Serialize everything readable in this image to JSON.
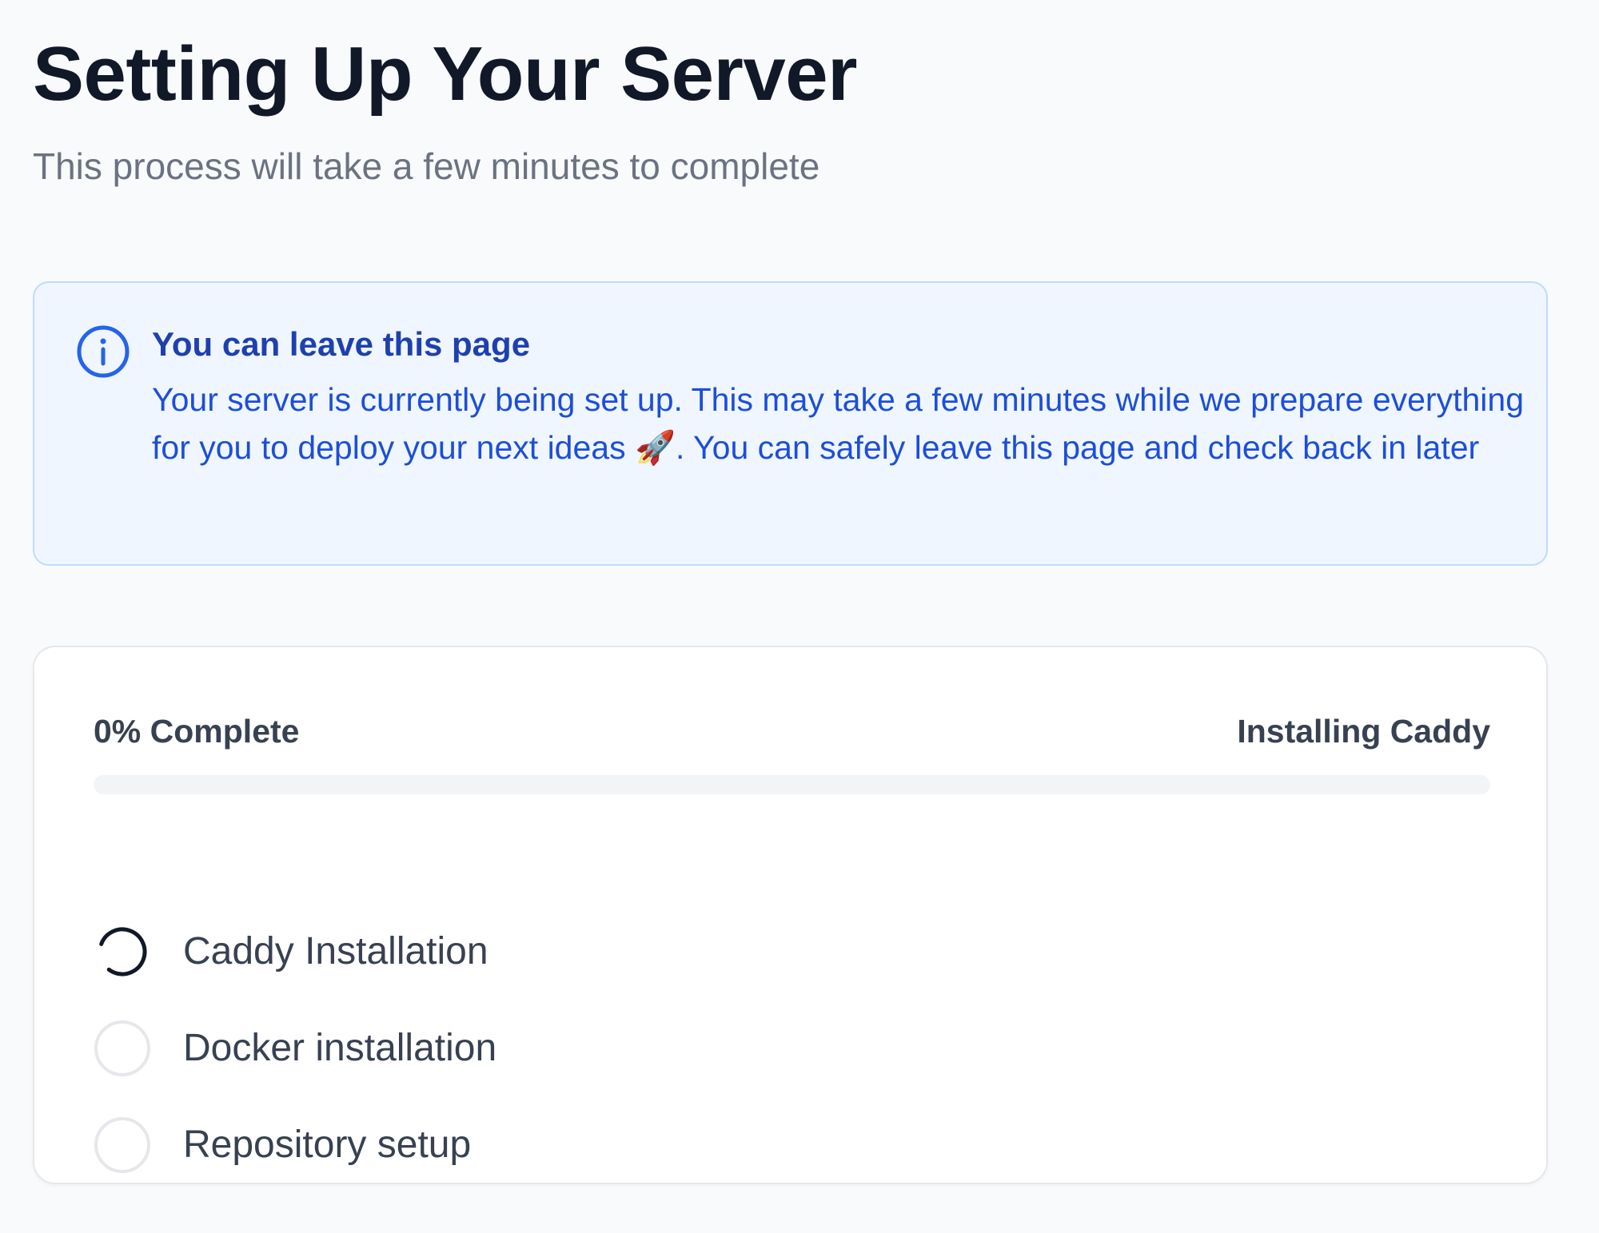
{
  "header": {
    "title": "Setting Up Your Server",
    "subtitle": "This process will take a few minutes to complete"
  },
  "notice": {
    "icon": "info-circle-icon",
    "heading": "You can leave this page",
    "body": "Your server is currently being set up. This may take a few minutes while we prepare everything for you to deploy your next ideas 🚀. You can safely leave this page and check back in later",
    "accent_color": "#1d4ed8",
    "background_color": "#eff6ff",
    "border_color": "#bfdbfe"
  },
  "progress": {
    "percent_label": "0% Complete",
    "status_label": "Installing Caddy",
    "percent": 0
  },
  "steps": [
    {
      "label": "Caddy Installation",
      "state": "in-progress",
      "icon": "spinner-icon"
    },
    {
      "label": "Docker installation",
      "state": "pending",
      "icon": "empty-circle-icon"
    },
    {
      "label": "Repository setup",
      "state": "pending",
      "icon": "empty-circle-icon"
    }
  ]
}
